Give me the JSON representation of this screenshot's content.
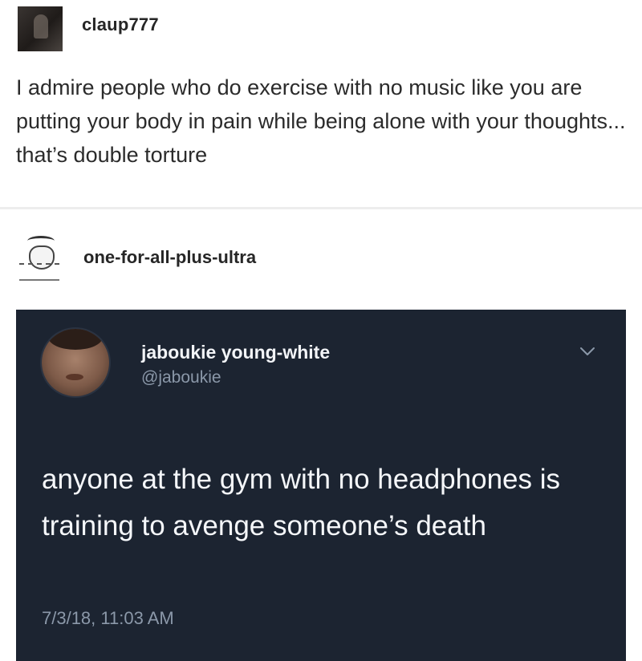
{
  "post1": {
    "username": "claup777",
    "avatar_icon": "user-avatar-photo",
    "body": "I admire people who do exercise with no music like you are putting your body in pain while being alone with your thoughts... that’s double torture"
  },
  "reblog": {
    "username": "one-for-all-plus-ultra",
    "avatar_icon": "sketch-drawing-avatar"
  },
  "tweet": {
    "display_name": "jaboukie young-white",
    "handle": "@jaboukie",
    "text": "anyone at the gym with no headphones is training to avenge someone’s death",
    "timestamp": "7/3/18, 11:03 AM",
    "chevron_icon": "chevron-down-icon",
    "background_color": "#1c2431"
  }
}
